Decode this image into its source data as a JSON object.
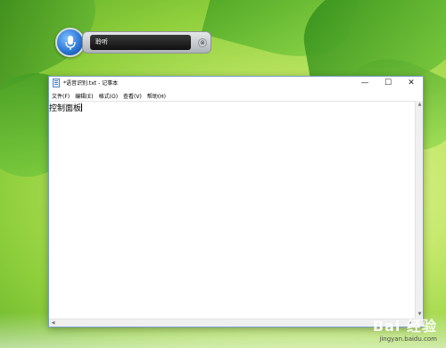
{
  "speech": {
    "status_text": "聆听",
    "close_glyph": "⊗"
  },
  "notepad": {
    "title": "*语音识别.txt - 记事本",
    "controls": {
      "minimize": "—",
      "maximize": "☐",
      "close": "✕"
    },
    "menus": [
      "文件(F)",
      "编辑(E)",
      "格式(O)",
      "查看(V)",
      "帮助(H)"
    ],
    "content": "控制面板",
    "scroll_up": "▲",
    "scroll_down": "▼",
    "scroll_left": "◀",
    "scroll_right": "▶"
  },
  "watermark": {
    "logo": "Bai 经验",
    "url": "jingyan.baidu.com"
  }
}
